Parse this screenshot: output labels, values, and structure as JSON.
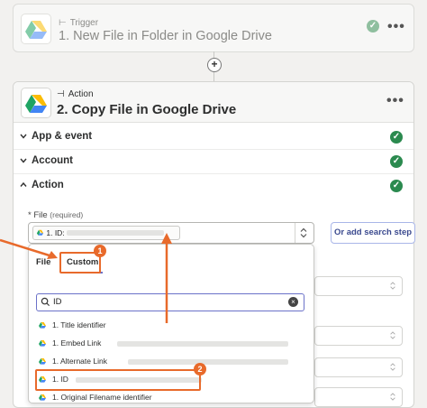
{
  "trigger": {
    "kicker": "Trigger",
    "title": "1. New File in Folder in Google Drive"
  },
  "action": {
    "kicker": "Action",
    "title": "2. Copy File in Google Drive"
  },
  "sections": {
    "app_event": "App & event",
    "account": "Account",
    "action": "Action"
  },
  "file_field": {
    "label": "File",
    "required": "(required)",
    "chip_label": "1. ID:",
    "search_step_button": "Or add search step"
  },
  "dropdown": {
    "tabs": [
      "File",
      "Custom"
    ],
    "search_value": "ID",
    "options": [
      {
        "label": "1. Title",
        "suffix": "identifier"
      },
      {
        "label": "1. Embed Link",
        "suffix": ""
      },
      {
        "label": "1. Alternate Link",
        "suffix": ""
      },
      {
        "label": "1. ID",
        "suffix": ""
      },
      {
        "label": "1. Original Filename",
        "suffix": "identifier"
      }
    ]
  },
  "callouts": [
    "1",
    "2"
  ],
  "colors": {
    "accent_orange": "#e86a2b",
    "success_green": "#2b8a4f",
    "brand_purple": "#6b72c9"
  },
  "icons": [
    "google-drive-icon",
    "more-dots-icon",
    "check-icon",
    "chevron-down-icon",
    "plus-icon",
    "search-icon",
    "clear-icon"
  ]
}
